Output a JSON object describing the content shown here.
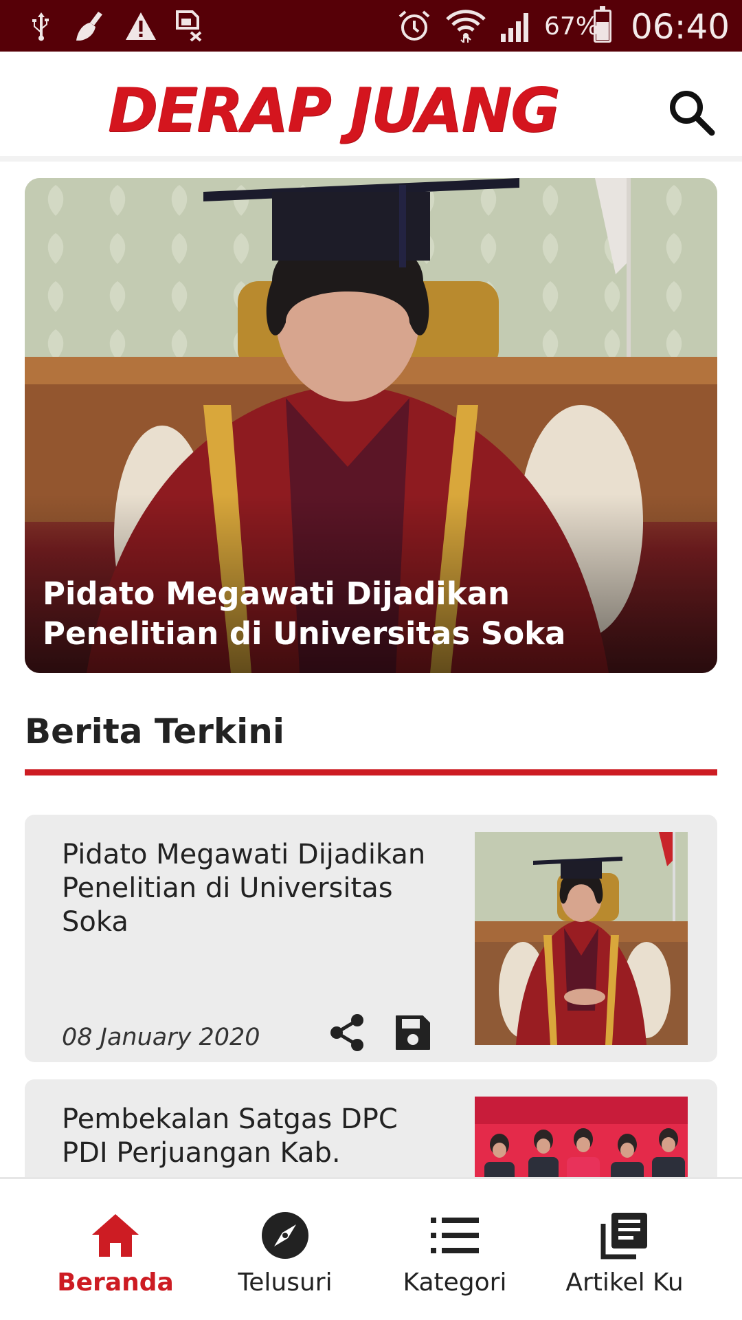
{
  "status_bar": {
    "battery": "67%",
    "time": "06:40"
  },
  "header": {
    "logo_text": "DERAP JUANG",
    "search_icon": "search-icon"
  },
  "hero": {
    "title": "Pidato Megawati Dijadikan Penelitian di Universitas Soka"
  },
  "section": {
    "title": "Berita Terkini"
  },
  "articles": [
    {
      "title": "Pidato Megawati Dijadikan Penelitian di Universitas Soka",
      "date": "08 January 2020",
      "share_icon": "share-icon",
      "save_icon": "save-icon"
    },
    {
      "title": "Pembekalan Satgas DPC PDI Perjuangan Kab."
    }
  ],
  "bottom_nav": [
    {
      "label": "Beranda",
      "icon": "home-icon",
      "active": true
    },
    {
      "label": "Telusuri",
      "icon": "compass-icon",
      "active": false
    },
    {
      "label": "Kategori",
      "icon": "list-icon",
      "active": false
    },
    {
      "label": "Artikel Ku",
      "icon": "library-icon",
      "active": false
    }
  ],
  "colors": {
    "status_bar": "#560007",
    "accent": "#cd1c23",
    "card_bg": "#ececec"
  }
}
